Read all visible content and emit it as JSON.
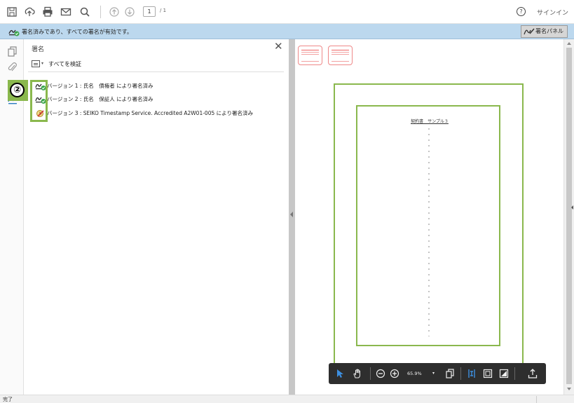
{
  "toolbar": {
    "icons": [
      "save-icon",
      "upload-icon",
      "print-icon",
      "email-icon",
      "search-icon",
      "page-up-icon",
      "page-down-icon"
    ],
    "page_current": "1",
    "page_total": "/ 1",
    "help_glyph": "?",
    "signin_label": "サインイン"
  },
  "banner": {
    "text": "署名済みであり、すべての署名が有効です。",
    "sig_panel_button": "署名パネル"
  },
  "signature_panel": {
    "title": "署名",
    "close_glyph": "✕",
    "verify_all_label": "すべてを検証",
    "revisions": [
      {
        "label": "バージョン 1 : 氏名　債権者 により署名済み"
      },
      {
        "label": "バージョン 2 : 氏名　保証人 により署名済み"
      },
      {
        "label": "バージョン 3 : SEIKO Timestamp Service. Accredited A2W01-005 により署名済み"
      }
    ],
    "callout_number": "②"
  },
  "document": {
    "heading": "契約書　サンプル３"
  },
  "float_toolbar": {
    "zoom_value": "65.9%",
    "zoom_caret": "▾"
  },
  "status": {
    "text": "完了"
  },
  "colors": {
    "accent_green": "#8ab84d",
    "banner_blue": "#bcd8ee",
    "valid_green": "#3aa54a"
  }
}
